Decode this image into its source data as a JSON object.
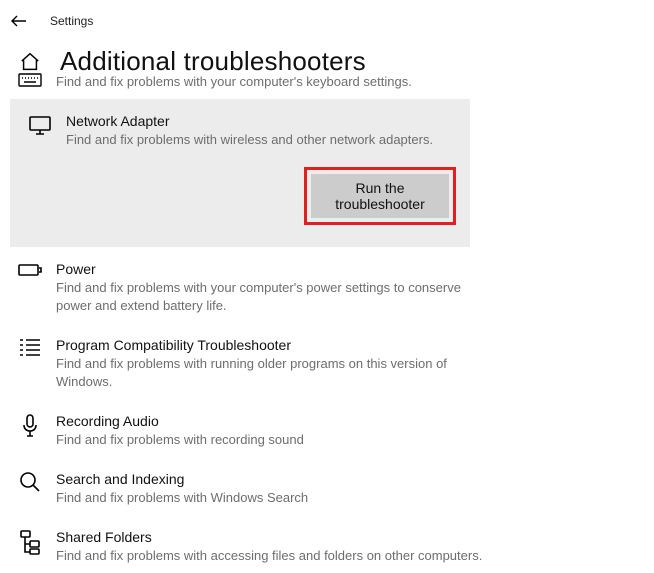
{
  "header": {
    "app_title": "Settings"
  },
  "page_title": "Additional troubleshooters",
  "items": {
    "keyboard": {
      "desc": "Find and fix problems with your computer's keyboard settings."
    },
    "network_adapter": {
      "title": "Network Adapter",
      "desc": "Find and fix problems with wireless and other network adapters.",
      "run_label": "Run the troubleshooter"
    },
    "power": {
      "title": "Power",
      "desc": "Find and fix problems with your computer's power settings to conserve power and extend battery life."
    },
    "compat": {
      "title": "Program Compatibility Troubleshooter",
      "desc": "Find and fix problems with running older programs on this version of Windows."
    },
    "recording": {
      "title": "Recording Audio",
      "desc": "Find and fix problems with recording sound"
    },
    "search": {
      "title": "Search and Indexing",
      "desc": "Find and fix problems with Windows Search"
    },
    "shared": {
      "title": "Shared Folders",
      "desc": "Find and fix problems with accessing files and folders on other computers."
    }
  }
}
